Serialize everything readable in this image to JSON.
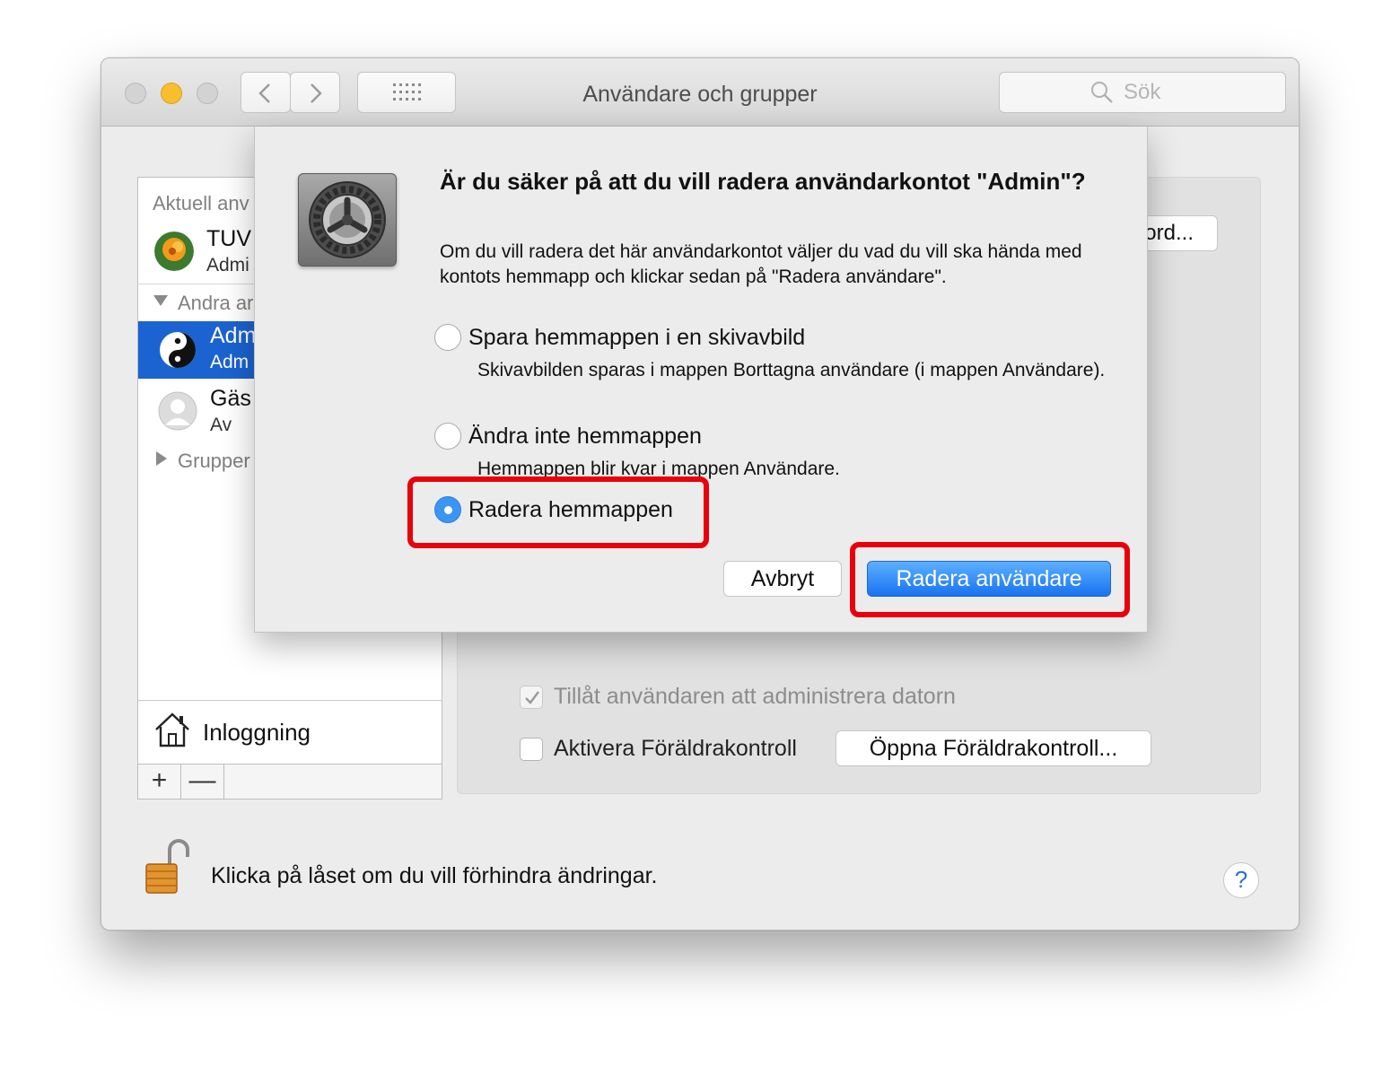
{
  "window": {
    "title": "Användare och grupper",
    "search_placeholder": "Sök"
  },
  "sidebar": {
    "current_users_label": "Aktuell anv",
    "current_user": {
      "name": "TUV",
      "role": "Admi"
    },
    "other_users_label": "Andra ar",
    "other_users": [
      {
        "name": "Adm",
        "role": "Adm",
        "selected": true
      },
      {
        "name": "Gäs",
        "role": "Av",
        "selected": false
      }
    ],
    "groups_label": "Grupper",
    "login_label": "Inloggning",
    "add_label": "+",
    "remove_label": "—"
  },
  "panel": {
    "password_button": "ord...",
    "allow_admin_label": "Tillåt användaren att administrera datorn",
    "parental_label": "Aktivera Föräldrakontroll",
    "parental_button": "Öppna Föräldrakontroll..."
  },
  "footer": {
    "lock_text": "Klicka på låset om du vill förhindra ändringar.",
    "help_label": "?"
  },
  "dialog": {
    "title": "Är du säker på att du vill radera användarkontot \"Admin\"?",
    "message": "Om du vill radera det här användarkontot väljer du vad du vill ska hända med kontots hemmapp och klickar sedan på \"Radera användare\".",
    "options": [
      {
        "label": "Spara hemmappen i en skivavbild",
        "desc": "Skivavbilden sparas i mappen Borttagna användare (i mappen Användare).",
        "selected": false
      },
      {
        "label": "Ändra inte hemmappen",
        "desc": "Hemmappen blir kvar i mappen Användare.",
        "selected": false
      },
      {
        "label": "Radera hemmappen",
        "desc": "",
        "selected": true
      }
    ],
    "cancel_button": "Avbryt",
    "confirm_button": "Radera användare"
  },
  "colors": {
    "accent": "#1b63d0",
    "highlight": "#e8000b",
    "primary_button": "#1873f0"
  }
}
